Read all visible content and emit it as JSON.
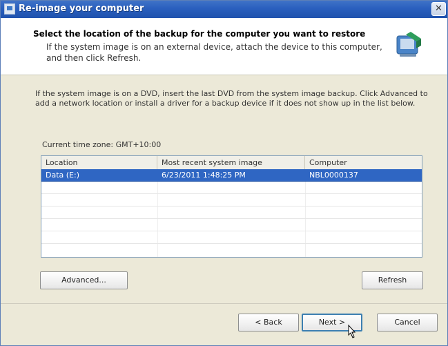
{
  "window": {
    "title": "Re-image your computer",
    "close_glyph": "✕"
  },
  "header": {
    "title": "Select the location of the backup for the computer you want to restore",
    "description": "If the system image is on an external device, attach the device to this computer, and then click Refresh.",
    "icon": "backup-device-icon"
  },
  "content": {
    "instructions": "If the system image is on a DVD, insert the last DVD from the system image backup. Click Advanced to add a network location or install a driver for a backup device if it does not show up in the list below.",
    "timezone_label": "Current time zone: GMT+10:00"
  },
  "table": {
    "columns": [
      "Location",
      "Most recent system image",
      "Computer"
    ],
    "rows": [
      {
        "location": "Data (E:)",
        "image": "6/23/2011 1:48:25 PM",
        "computer": "NBL0000137",
        "selected": true
      }
    ]
  },
  "buttons": {
    "advanced": "Advanced...",
    "refresh": "Refresh",
    "back": "< Back",
    "next": "Next >",
    "cancel": "Cancel"
  },
  "colors": {
    "title_bar": "#2a5fbe",
    "selection": "#2f66c3",
    "dialog_bg": "#ece9d8"
  }
}
